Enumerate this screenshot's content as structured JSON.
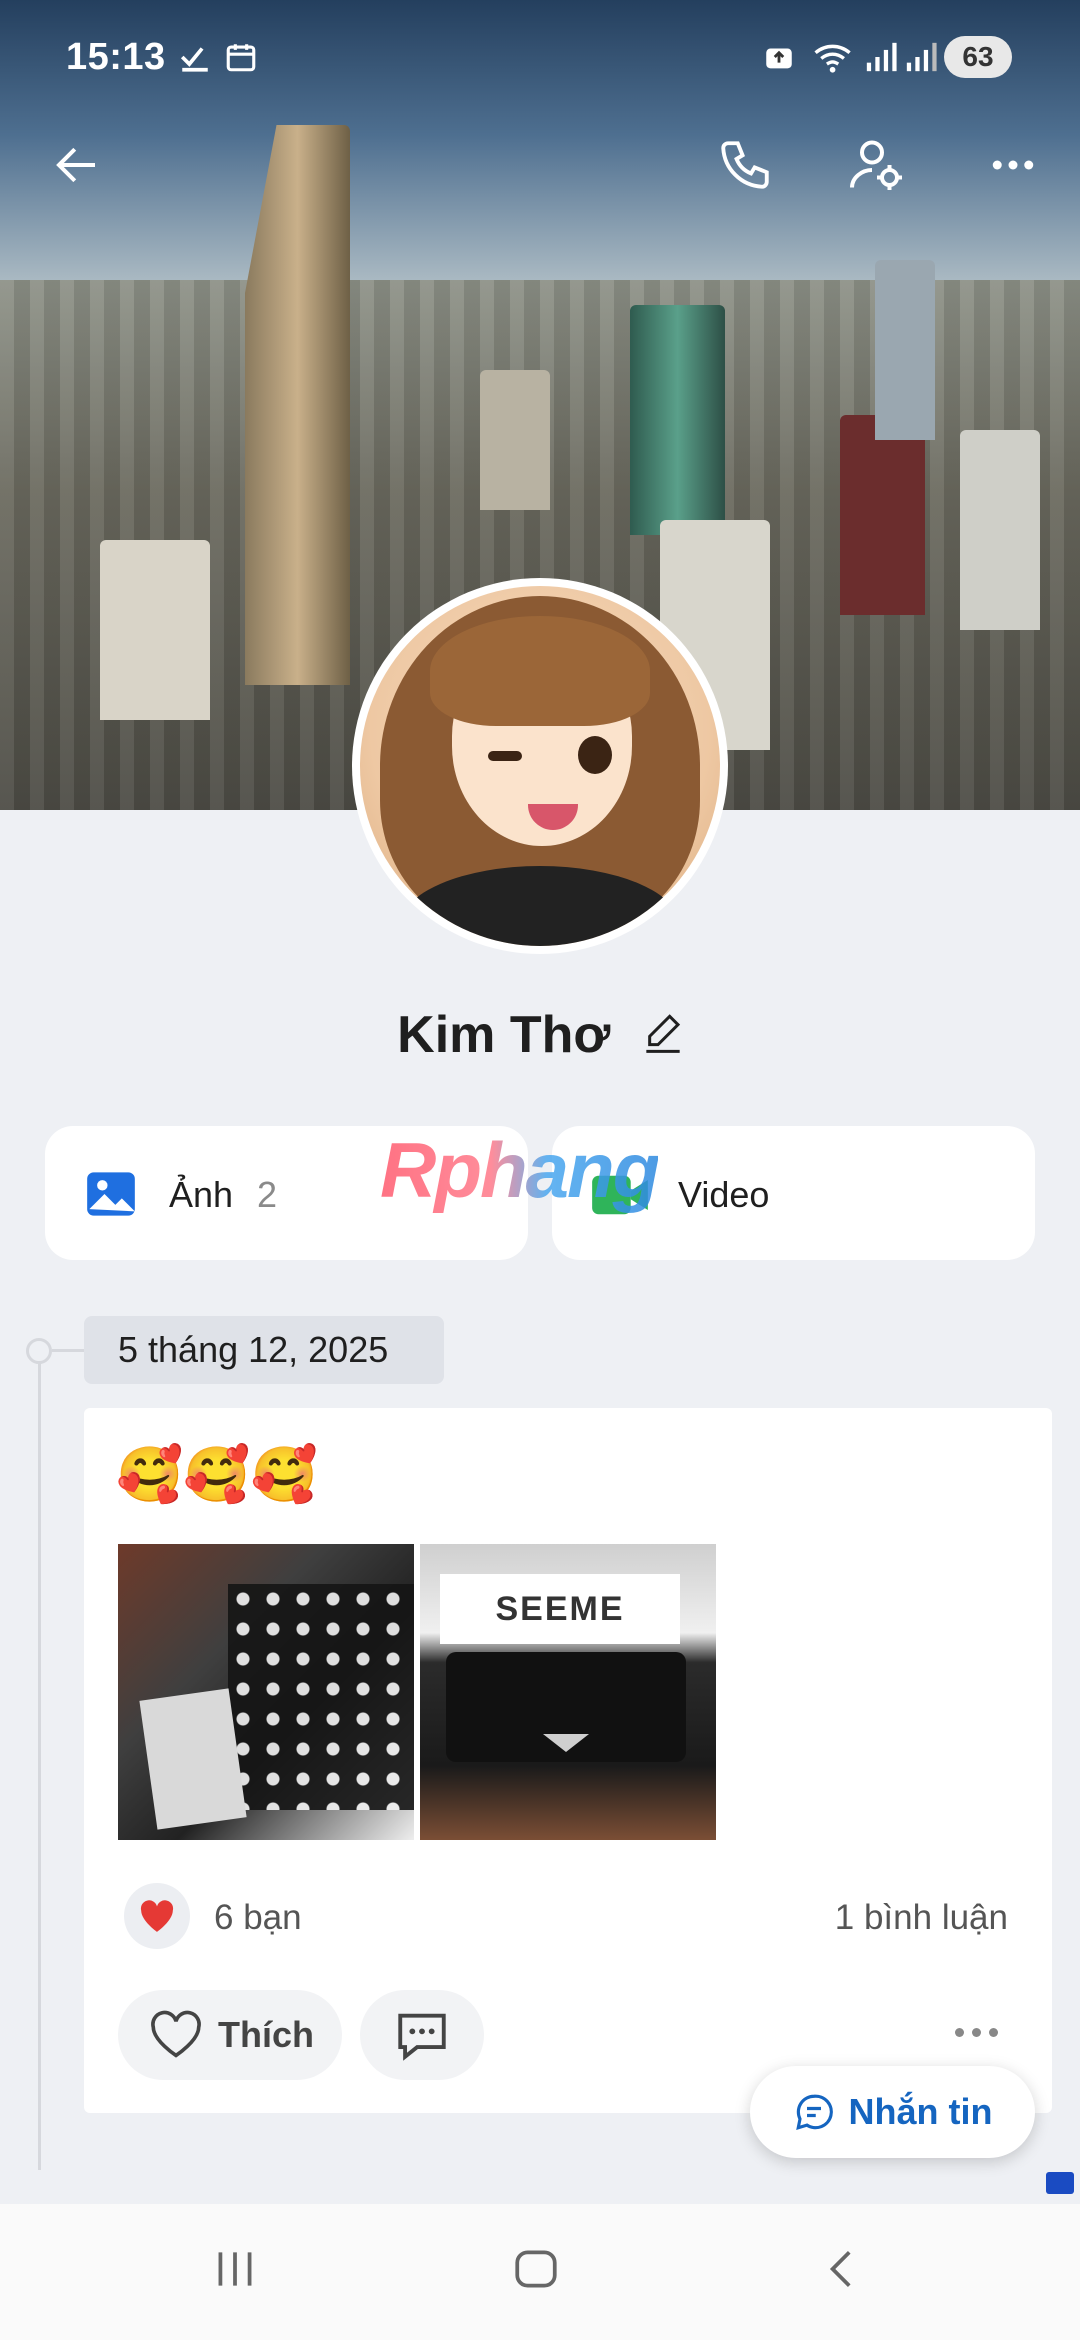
{
  "status_bar": {
    "time": "15:13",
    "battery": "63"
  },
  "header": {
    "back_icon": "arrow-left-icon",
    "call_icon": "phone-icon",
    "settings_icon": "user-settings-icon",
    "more_icon": "more-horizontal-icon"
  },
  "profile": {
    "name": "Kim Thơ"
  },
  "media_cards": {
    "photos": {
      "label": "Ảnh",
      "count": "2"
    },
    "video": {
      "label": "Video"
    }
  },
  "watermark": "Rphang",
  "timeline": {
    "date": "5 tháng 12, 2025",
    "post": {
      "text": "🥰🥰🥰",
      "photo2_text": "SEEME",
      "reactions": "6 bạn",
      "comments": "1 bình luận",
      "like_label": "Thích"
    }
  },
  "message_button": {
    "label": "Nhắn tin"
  },
  "colors": {
    "accent": "#1565c0",
    "background": "#eef0f4",
    "heart": "#e53935"
  }
}
